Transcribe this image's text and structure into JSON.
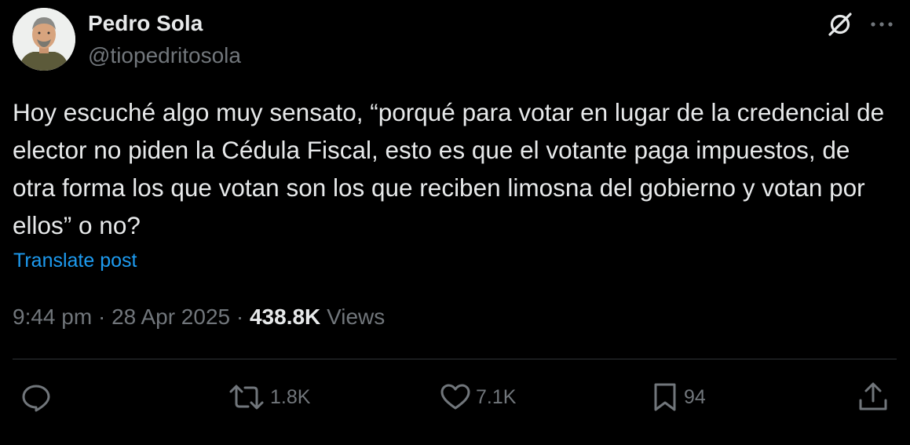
{
  "author": {
    "display_name": "Pedro Sola",
    "handle": "@tiopedritosola"
  },
  "post": {
    "text": "Hoy escuché algo muy sensato, “porqué para votar en lugar de la credencial de elector no piden la Cédula Fiscal, esto es que el votante paga impuestos, de otra forma los que votan son los que reciben limosna del gobierno y votan por ellos” o no?",
    "translate_label": "Translate post",
    "time": "9:44 pm",
    "separator": "·",
    "date": "28 Apr 2025",
    "views_count": "438.8K",
    "views_label": "Views"
  },
  "actions": {
    "reply_count": "",
    "retweet_count": "1.8K",
    "like_count": "7.1K",
    "bookmark_count": "94"
  },
  "colors": {
    "background": "#000000",
    "primary_text": "#e7e9ea",
    "secondary_text": "#71767b",
    "link": "#1d9bf0",
    "divider": "#2f3336"
  },
  "icons": {
    "grok": "grok-icon",
    "more": "more-icon",
    "reply": "reply-icon",
    "retweet": "retweet-icon",
    "like": "heart-icon",
    "bookmark": "bookmark-icon",
    "share": "share-icon"
  }
}
